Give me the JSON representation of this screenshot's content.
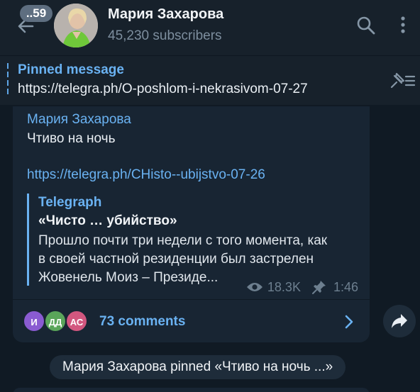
{
  "header": {
    "unread_count": "..59",
    "title": "Мария Захарова",
    "subtitle": "45,230 subscribers"
  },
  "pinned": {
    "label": "Pinned message",
    "text": "https://telegra.ph/O-poshlom-i-nekrasivom-07-27"
  },
  "message": {
    "author": "Мария Захарова",
    "text": "Чтиво на ночь",
    "link": "https://telegra.ph/CHisto--ubijstvo-07-26",
    "preview": {
      "site": "Telegraph",
      "title": "«Чисто … убийство»",
      "description_lines": [
        "Прошло почти три недели с того момента, как",
        "в своей частной резиденции был застрелен",
        "Жовенель Моиз – Президе..."
      ]
    },
    "views": "18.3K",
    "time": "1:46",
    "comments": {
      "avatars": [
        {
          "initials": "И",
          "color": "#8a5bd1"
        },
        {
          "initials": "ДД",
          "color": "#5aa55a"
        },
        {
          "initials": "АС",
          "color": "#d2577f"
        }
      ],
      "label": "73 comments"
    }
  },
  "service_message": "Мария Захарова pinned «Чтиво на ночь  ...»",
  "colors": {
    "accent": "#6ab2f2",
    "bubble": "#182533",
    "background": "#101a24",
    "header": "#17212b"
  }
}
